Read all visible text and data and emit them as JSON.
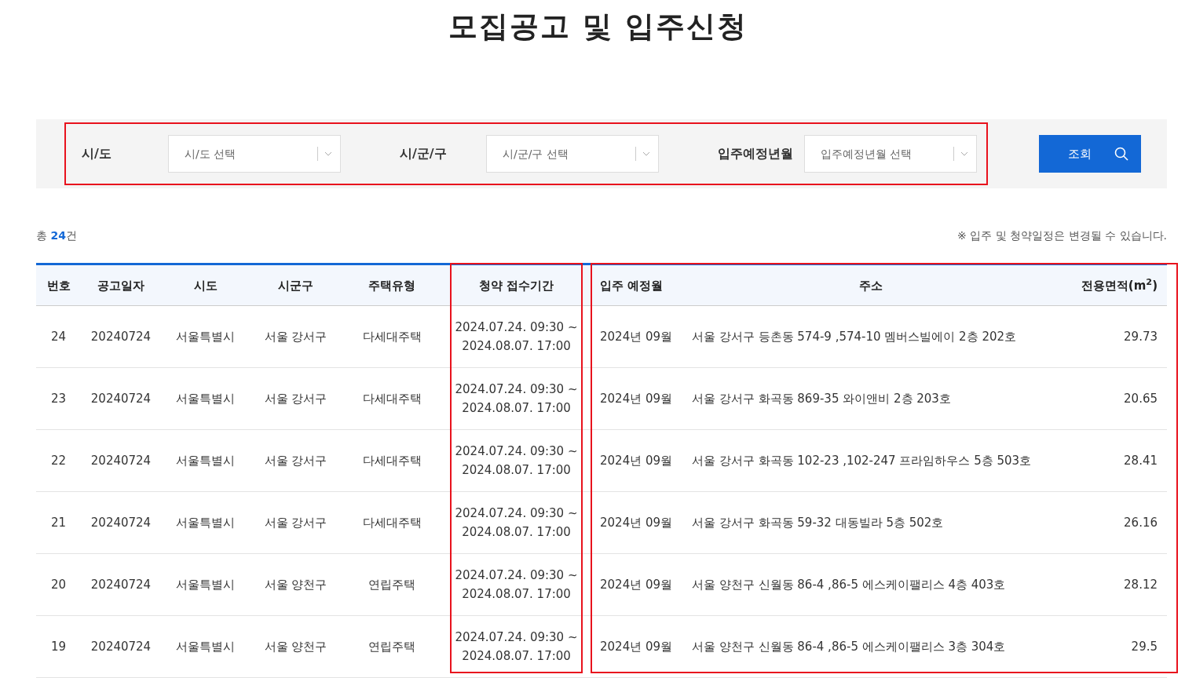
{
  "page_title": "모집공고 및 입주신청",
  "filters": {
    "highlighted": true,
    "fields": [
      {
        "label": "시/도",
        "placeholder": "시/도 선택"
      },
      {
        "label": "시/군/구",
        "placeholder": "시/군/구 선택"
      },
      {
        "label": "입주예정년월",
        "placeholder": "입주예정년월 선택"
      }
    ]
  },
  "search_button": "조회",
  "total": "총 **24**건",
  "notice": "※ 입주 및 청약일정은 변경될 수 있습니다.",
  "table": {
    "column_groups": [
      {
        "columns": [
          "번호",
          "공고일자",
          "시도",
          "시군구",
          "주택유형"
        ]
      },
      {
        "highlighted": true,
        "columns": [
          "청약 접수기간"
        ]
      },
      {
        "highlighted": true,
        "columns": [
          "입주 예정월",
          "주소",
          "전용면적(m$^{2}$)"
        ]
      }
    ],
    "rows": [
      [
        "24",
        "20240724",
        "서울특별시",
        "서울 강서구",
        "다세대주택",
        [
          "2024.07.24. 09:30 ~",
          "2024.08.07. 17:00"
        ],
        "2024년 09월",
        "서울 강서구 등촌동 574-9 ,574-10 멤버스빌에이 2층 202호",
        "29.73"
      ],
      [
        "23",
        "20240724",
        "서울특별시",
        "서울 강서구",
        "다세대주택",
        [
          "2024.07.24. 09:30 ~",
          "2024.08.07. 17:00"
        ],
        "2024년 09월",
        "서울 강서구 화곡동 869-35 와이앤비 2층 203호",
        "20.65"
      ],
      [
        "22",
        "20240724",
        "서울특별시",
        "서울 강서구",
        "다세대주택",
        [
          "2024.07.24. 09:30 ~",
          "2024.08.07. 17:00"
        ],
        "2024년 09월",
        "서울 강서구 화곡동 102-23 ,102-247 프라임하우스 5층 503호",
        "28.41"
      ],
      [
        "21",
        "20240724",
        "서울특별시",
        "서울 강서구",
        "다세대주택",
        [
          "2024.07.24. 09:30 ~",
          "2024.08.07. 17:00"
        ],
        "2024년 09월",
        "서울 강서구 화곡동 59-32 대동빌라 5층 502호",
        "26.16"
      ],
      [
        "20",
        "20240724",
        "서울특별시",
        "서울 양천구",
        "연립주택",
        [
          "2024.07.24. 09:30 ~",
          "2024.08.07. 17:00"
        ],
        "2024년 09월",
        "서울 양천구 신월동 86-4 ,86-5 에스케이팰리스 4층 403호",
        "28.12"
      ],
      [
        "19",
        "20240724",
        "서울특별시",
        "서울 양천구",
        "연립주택",
        [
          "2024.07.24. 09:30 ~",
          "2024.08.07. 17:00"
        ],
        "2024년 09월",
        "서울 양천구 신월동 86-4 ,86-5 에스케이팰리스 3층 304호",
        "29.5"
      ]
    ]
  }
}
